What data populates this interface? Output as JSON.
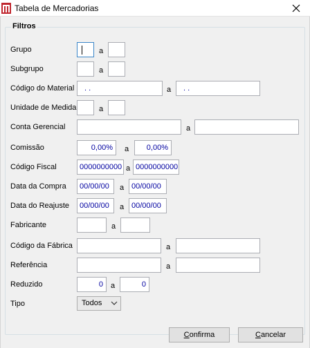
{
  "window": {
    "title": "Tabela de Mercadorias"
  },
  "group": {
    "title": "Filtros"
  },
  "separator": "a",
  "fields": {
    "grupo": {
      "label": "Grupo",
      "from": "",
      "to": ""
    },
    "subgrupo": {
      "label": "Subgrupo",
      "from": "",
      "to": ""
    },
    "codigo_material": {
      "label": "Código do Material",
      "from": " .  .",
      "to": " .  ."
    },
    "unidade_medida": {
      "label": "Unidade de Medida",
      "from": "",
      "to": ""
    },
    "conta_gerencial": {
      "label": "Conta Gerencial",
      "from": "",
      "to": ""
    },
    "comissao": {
      "label": "Comissão",
      "from": "0,00%",
      "to": "0,00%"
    },
    "codigo_fiscal": {
      "label": "Código Fiscal",
      "from": "0000000000",
      "to": "0000000000"
    },
    "data_compra": {
      "label": "Data da Compra",
      "from": "00/00/00",
      "to": "00/00/00"
    },
    "data_reajuste": {
      "label": "Data do Reajuste",
      "from": "00/00/00",
      "to": "00/00/00"
    },
    "fabricante": {
      "label": "Fabricante",
      "from": "",
      "to": ""
    },
    "codigo_fabrica": {
      "label": "Código da Fábrica",
      "from": "",
      "to": ""
    },
    "referencia": {
      "label": "Referência",
      "from": "",
      "to": ""
    },
    "reduzido": {
      "label": "Reduzido",
      "from": "0",
      "to": "0"
    },
    "tipo": {
      "label": "Tipo",
      "value": "Todos"
    }
  },
  "buttons": {
    "confirma": {
      "hotkey": "C",
      "rest": "onfirma"
    },
    "cancelar": {
      "hotkey": "C",
      "rest": "ancelar"
    }
  },
  "icons": {
    "app": "app-logo-icon",
    "close": "close-icon",
    "chevron": "chevron-down-icon"
  },
  "colors": {
    "field_text": "#0000a0",
    "app_icon": "#c0262e"
  }
}
